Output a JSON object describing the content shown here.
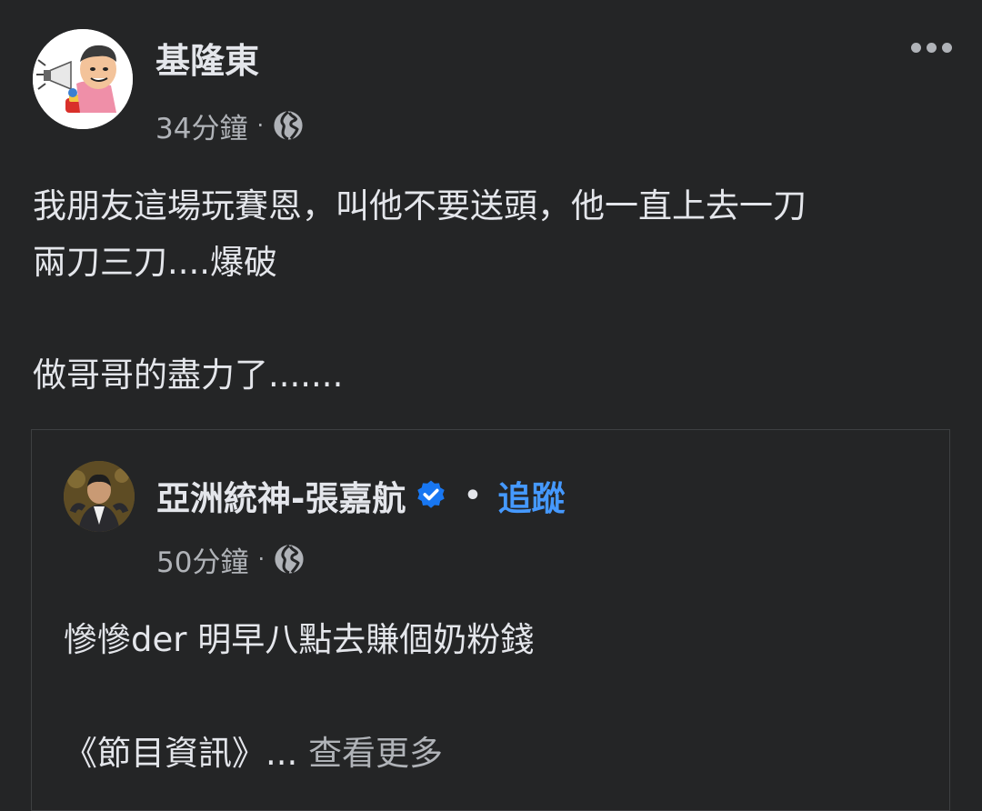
{
  "post": {
    "author": "基隆東",
    "time": "34分鐘",
    "meta_separator": "·",
    "privacy_icon": "globe-icon",
    "more_icon": "more-options-icon",
    "lines": [
      "我朋友這場玩賽恩，叫他不要送頭，他一直上去一刀",
      "兩刀三刀....爆破",
      "做哥哥的盡力了......."
    ]
  },
  "shared": {
    "author": "亞洲統神-張嘉航",
    "verified_icon": "verified-badge-icon",
    "separator": "•",
    "follow_label": "追蹤",
    "time": "50分鐘",
    "meta_separator": "·",
    "privacy_icon": "globe-icon",
    "text": "慘慘der  明早八點去賺個奶粉錢",
    "program_info": "《節目資訊》...",
    "see_more": "查看更多"
  },
  "colors": {
    "background": "#242526",
    "primary_text": "#e4e6eb",
    "secondary_text": "#b0b3b8",
    "link": "#4599ff",
    "verified": "#1877f2"
  }
}
